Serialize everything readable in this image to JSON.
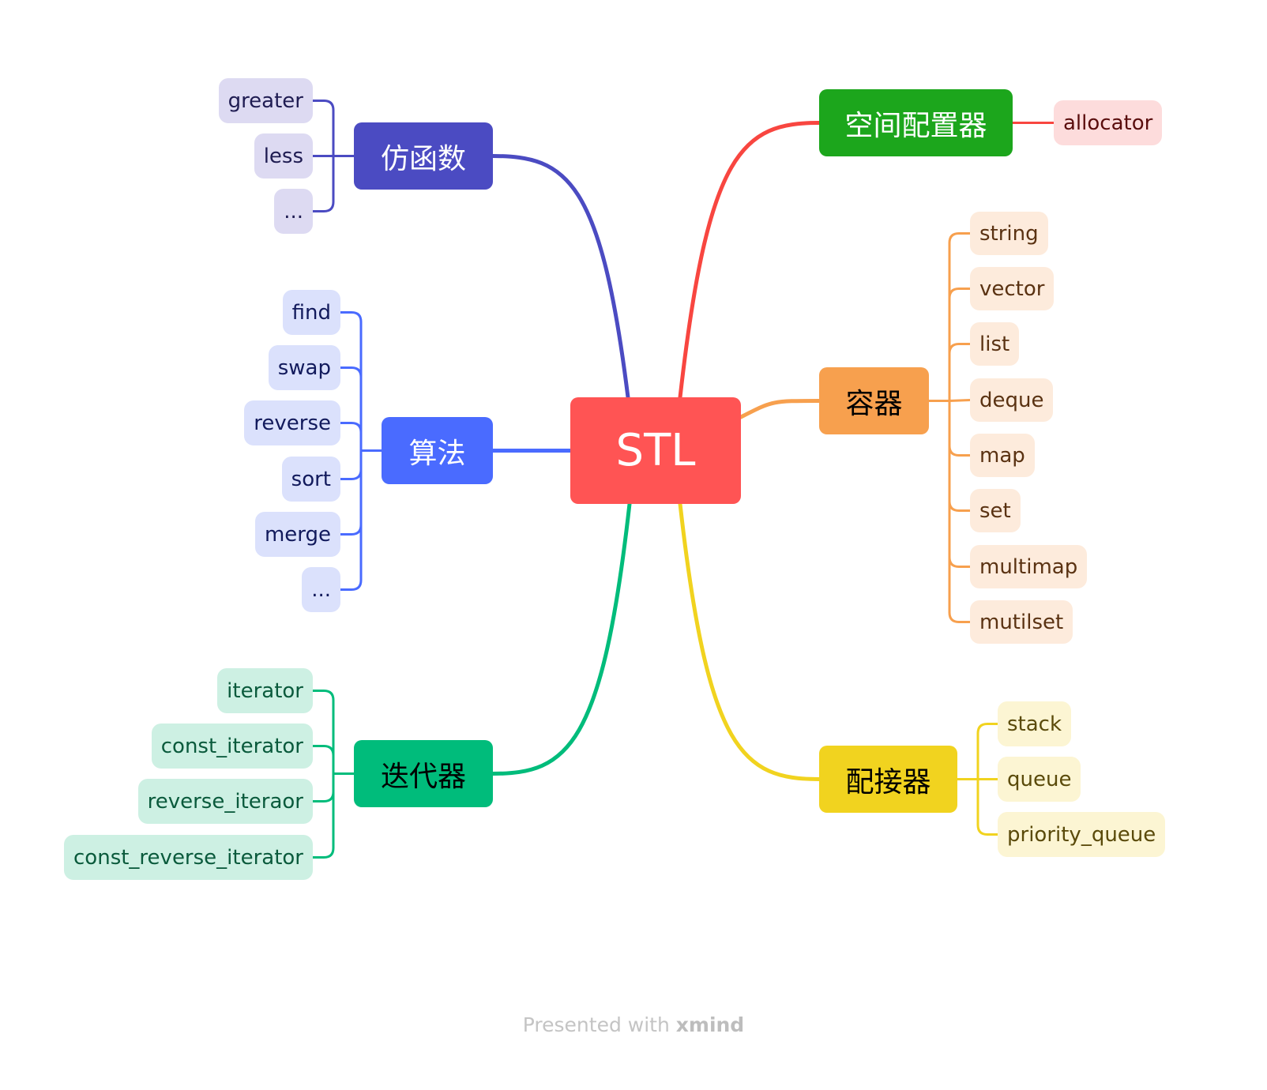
{
  "root": {
    "label": "STL",
    "color": "#ff5454"
  },
  "branches": [
    {
      "id": "functor",
      "label": "仿函数",
      "side": "left",
      "color": "#4b4bc2",
      "text_color": "#ffffff",
      "child_bg": "#dddaf2",
      "child_text": "#1f1c52",
      "children": [
        "greater",
        "less",
        "..."
      ]
    },
    {
      "id": "algorithm",
      "label": "算法",
      "side": "left",
      "color": "#4a6bff",
      "text_color": "#ffffff",
      "child_bg": "#dbe1fc",
      "child_text": "#121a5c",
      "children": [
        "find",
        "swap",
        "reverse",
        "sort",
        "merge",
        "..."
      ]
    },
    {
      "id": "iterator",
      "label": "迭代器",
      "side": "left",
      "color": "#00bc7b",
      "text_color": "#000000",
      "child_bg": "#cdf0e3",
      "child_text": "#0a5a3c",
      "children": [
        "iterator",
        "const_iterator",
        "reverse_iteraor",
        "const_reverse_iterator"
      ]
    },
    {
      "id": "allocator",
      "label": "空间配置器",
      "side": "right",
      "color": "#1ca61c",
      "text_color": "#ffffff",
      "line_color": "#f84640",
      "child_bg": "#fddcdc",
      "child_text": "#5a0d0d",
      "children": [
        "allocator"
      ]
    },
    {
      "id": "container",
      "label": "容器",
      "side": "right",
      "color": "#f7a04e",
      "text_color": "#000000",
      "child_bg": "#fdebdc",
      "child_text": "#5a3212",
      "children": [
        "string",
        "vector",
        "list",
        "deque",
        "map",
        "set",
        "multimap",
        "mutilset"
      ]
    },
    {
      "id": "adapter",
      "label": "配接器",
      "side": "right",
      "color": "#f1d31f",
      "text_color": "#000000",
      "child_bg": "#fcf5d3",
      "child_text": "#5a4a0a",
      "children": [
        "stack",
        "queue",
        "priority_queue"
      ]
    }
  ],
  "footer": {
    "prefix": "Presented with",
    "brand": "xmind"
  }
}
